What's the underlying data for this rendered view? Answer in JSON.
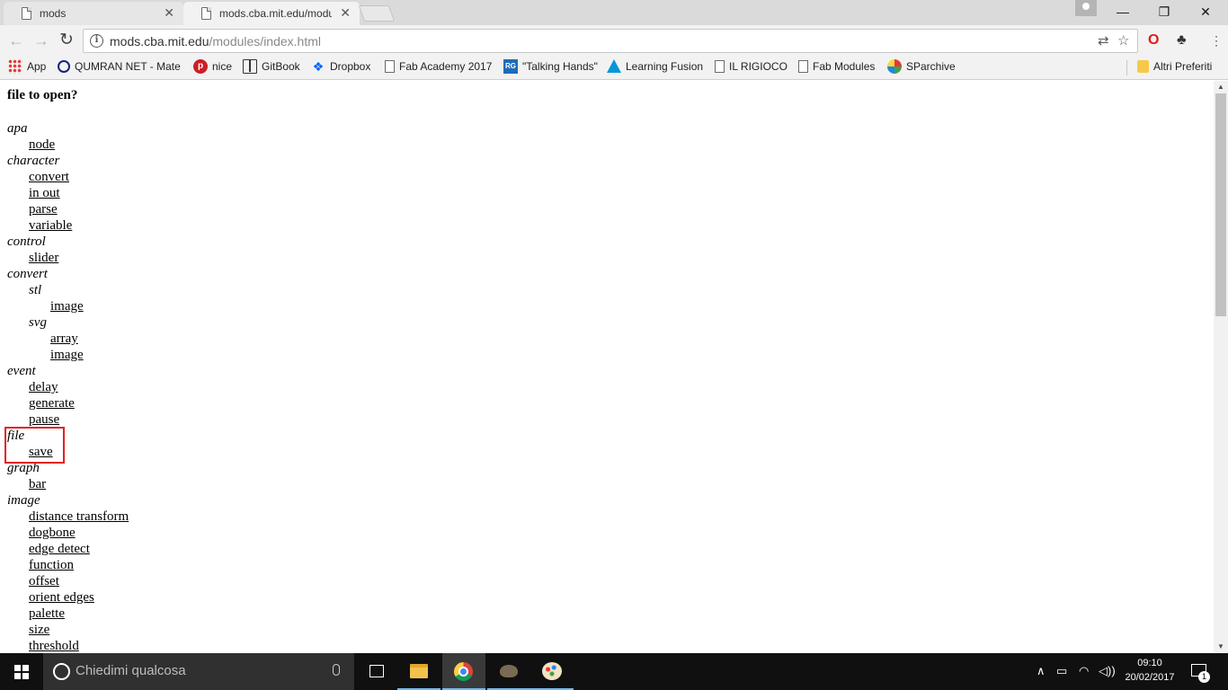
{
  "browser": {
    "tabs": [
      {
        "title": "mods",
        "active": false
      },
      {
        "title": "mods.cba.mit.edu/modu",
        "active": true
      }
    ],
    "address": {
      "host": "mods.cba.mit.edu",
      "path": "/modules/index.html"
    },
    "bookmarks": [
      {
        "label": "App",
        "icon": "apps-grid-icon"
      },
      {
        "label": "QUMRAN NET - Mate",
        "icon": "qumran-icon"
      },
      {
        "label": "nice",
        "icon": "pinterest-icon"
      },
      {
        "label": "GitBook",
        "icon": "gitbook-icon"
      },
      {
        "label": "Dropbox",
        "icon": "dropbox-icon"
      },
      {
        "label": "Fab Academy 2017",
        "icon": "page-icon"
      },
      {
        "label": "\"Talking Hands\"",
        "icon": "researchgate-icon"
      },
      {
        "label": "Learning Fusion",
        "icon": "autodesk-icon"
      },
      {
        "label": "IL RIGIOCO",
        "icon": "page-icon"
      },
      {
        "label": "Fab Modules",
        "icon": "page-icon"
      },
      {
        "label": "SParchive",
        "icon": "globe-icon"
      }
    ],
    "other_bookmarks": "Altri Preferiti"
  },
  "page": {
    "heading": "file to open?",
    "modules": [
      {
        "text": "apa",
        "type": "category",
        "level": 0
      },
      {
        "text": "node",
        "type": "link",
        "level": 1
      },
      {
        "text": "character",
        "type": "category",
        "level": 0
      },
      {
        "text": "convert",
        "type": "link",
        "level": 1
      },
      {
        "text": "in out",
        "type": "link",
        "level": 1
      },
      {
        "text": "parse",
        "type": "link",
        "level": 1
      },
      {
        "text": "variable",
        "type": "link",
        "level": 1
      },
      {
        "text": "control",
        "type": "category",
        "level": 0
      },
      {
        "text": "slider",
        "type": "link",
        "level": 1
      },
      {
        "text": "convert",
        "type": "category",
        "level": 0
      },
      {
        "text": "stl",
        "type": "category",
        "level": 1
      },
      {
        "text": "image",
        "type": "link",
        "level": 2
      },
      {
        "text": "svg",
        "type": "category",
        "level": 1
      },
      {
        "text": "array",
        "type": "link",
        "level": 2
      },
      {
        "text": "image",
        "type": "link",
        "level": 2
      },
      {
        "text": "event",
        "type": "category",
        "level": 0
      },
      {
        "text": "delay",
        "type": "link",
        "level": 1
      },
      {
        "text": "generate",
        "type": "link",
        "level": 1
      },
      {
        "text": "pause",
        "type": "link",
        "level": 1
      },
      {
        "text": "file",
        "type": "category",
        "level": 0
      },
      {
        "text": "save",
        "type": "link",
        "level": 1
      },
      {
        "text": "graph",
        "type": "category",
        "level": 0
      },
      {
        "text": "bar",
        "type": "link",
        "level": 1
      },
      {
        "text": "image",
        "type": "category",
        "level": 0
      },
      {
        "text": "distance transform",
        "type": "link",
        "level": 1
      },
      {
        "text": "dogbone",
        "type": "link",
        "level": 1
      },
      {
        "text": "edge detect",
        "type": "link",
        "level": 1
      },
      {
        "text": "function",
        "type": "link",
        "level": 1
      },
      {
        "text": "offset",
        "type": "link",
        "level": 1
      },
      {
        "text": "orient edges",
        "type": "link",
        "level": 1
      },
      {
        "text": "palette",
        "type": "link",
        "level": 1
      },
      {
        "text": "size",
        "type": "link",
        "level": 1
      },
      {
        "text": "threshold",
        "type": "link",
        "level": 1
      }
    ],
    "highlight_color": "#e31e24"
  },
  "taskbar": {
    "search_placeholder": "Chiedimi qualcosa",
    "time": "09:10",
    "date": "20/02/2017",
    "notification_count": "1"
  }
}
